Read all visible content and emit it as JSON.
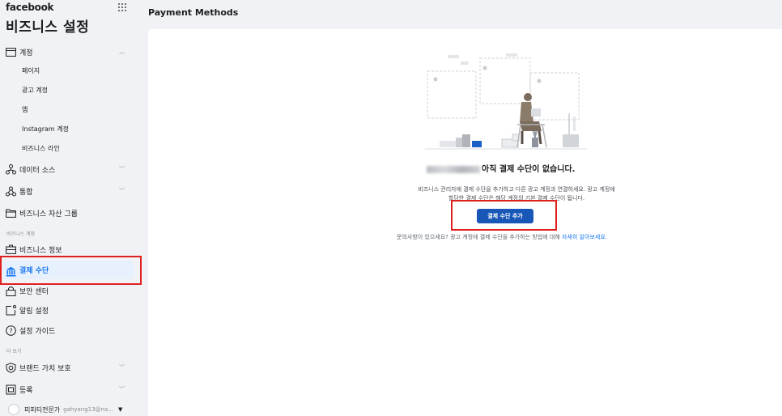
{
  "sidebar": {
    "brand": "facebook",
    "title": "비즈니스 설정",
    "account": {
      "label": "계정",
      "subitems": [
        "페이지",
        "광고 계정",
        "앱",
        "Instagram 계정",
        "비즈니스 라인"
      ]
    },
    "data_sources": "데이터 소스",
    "integrations": "통합",
    "asset_groups": "비즈니스 자산 그룹",
    "section_business_account": "비즈니스 계정",
    "business_info": "비즈니스 정보",
    "payment_methods": "결제 수단",
    "security_center": "보안 센터",
    "notification_settings": "알림 설정",
    "setup_guide": "설정 가이드",
    "section_more": "더 보기",
    "brand_protection": "브랜드 가치 보호",
    "registration": "등록",
    "user": {
      "name": "피피티전문가",
      "email": "gahyang13@na..."
    }
  },
  "main": {
    "page_title": "Payment Methods",
    "empty_state": {
      "title": "아직 결제 수단이 없습니다.",
      "description_line1": "비즈니스 관리자에 결제 수단을 추가하고 다른 광고 계정과 연결하세요. 광고 계정에",
      "description_line2": "할당한 결제 수단은 해당 계정의 기본 결제 수단이 됩니다.",
      "add_button": "결제 수단 추가",
      "help_text": "문의사항이 있으세요? 광고 계정에 결제 수단을 추가하는 방법에 대해",
      "help_link": "자세히 알아보세요."
    }
  },
  "colors": {
    "accent": "#1877f2",
    "button": "#1857b8",
    "highlight": "#e0201e"
  }
}
